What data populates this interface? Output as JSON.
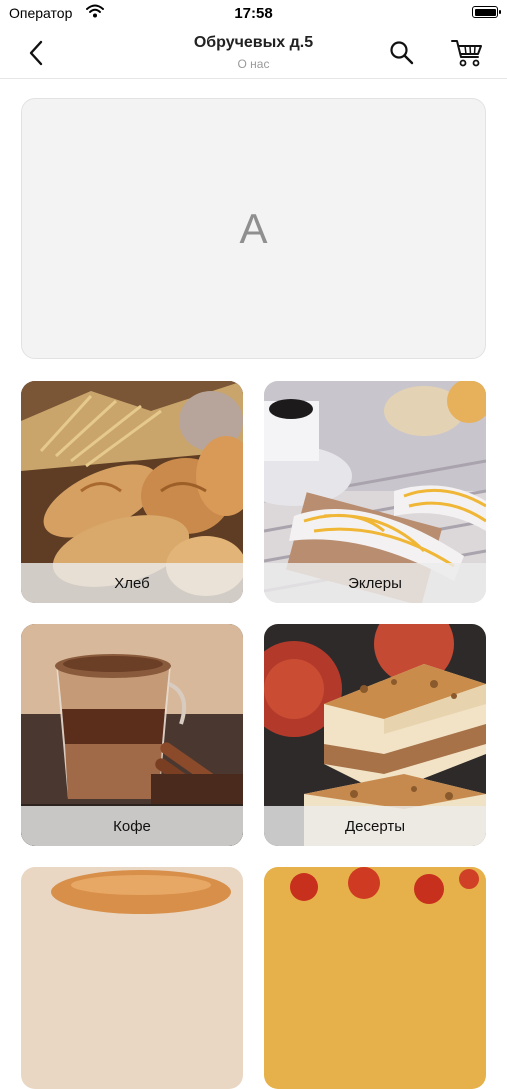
{
  "status_bar": {
    "carrier": "Оператор",
    "time": "17:58"
  },
  "nav": {
    "title": "Обручевых д.5",
    "subtitle": "О нас"
  },
  "banner": {
    "placeholder_letter": "A"
  },
  "categories": [
    {
      "label": "Хлеб"
    },
    {
      "label": "Эклеры"
    },
    {
      "label": "Кофе"
    },
    {
      "label": "Десерты"
    }
  ],
  "icons": {
    "back": "chevron-left-icon",
    "search": "search-icon",
    "cart": "cart-icon",
    "wifi": "wifi-icon",
    "battery": "battery-icon"
  }
}
